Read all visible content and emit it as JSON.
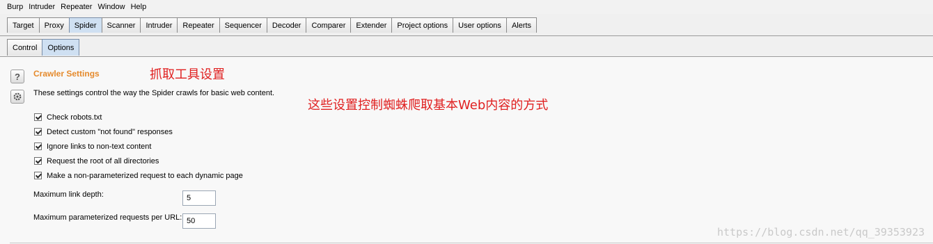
{
  "menubar": {
    "items": [
      "Burp",
      "Intruder",
      "Repeater",
      "Window",
      "Help"
    ]
  },
  "tabs": [
    {
      "label": "Target",
      "active": false
    },
    {
      "label": "Proxy",
      "active": false
    },
    {
      "label": "Spider",
      "active": true
    },
    {
      "label": "Scanner",
      "active": false
    },
    {
      "label": "Intruder",
      "active": false
    },
    {
      "label": "Repeater",
      "active": false
    },
    {
      "label": "Sequencer",
      "active": false
    },
    {
      "label": "Decoder",
      "active": false
    },
    {
      "label": "Comparer",
      "active": false
    },
    {
      "label": "Extender",
      "active": false
    },
    {
      "label": "Project options",
      "active": false
    },
    {
      "label": "User options",
      "active": false
    },
    {
      "label": "Alerts",
      "active": false
    }
  ],
  "subtabs": [
    {
      "label": "Control",
      "active": false
    },
    {
      "label": "Options",
      "active": true
    }
  ],
  "section": {
    "title": "Crawler Settings",
    "title_annotation": "抓取工具设置",
    "description": "These settings control the way the Spider crawls for basic web content.",
    "description_annotation": "这些设置控制蜘蛛爬取基本Web内容的方式",
    "checkboxes": [
      {
        "label": "Check robots.txt",
        "checked": true
      },
      {
        "label": "Detect custom \"not found\" responses",
        "checked": true
      },
      {
        "label": "Ignore links to non-text content",
        "checked": true
      },
      {
        "label": "Request the root of all directories",
        "checked": true
      },
      {
        "label": "Make a non-parameterized request to each dynamic page",
        "checked": true
      }
    ],
    "fields": {
      "max_link_depth": {
        "label": "Maximum link depth:",
        "value": "5"
      },
      "max_param_requests": {
        "label": "Maximum parameterized requests per URL:",
        "value": "50"
      }
    }
  },
  "icons": {
    "help": "help-question-icon",
    "settings": "gear-icon"
  },
  "watermark": "https://blog.csdn.net/qq_39353923",
  "colors": {
    "section_title": "#e58a2c",
    "annotation": "#e02020",
    "active_tab": "#cfe0f2"
  }
}
